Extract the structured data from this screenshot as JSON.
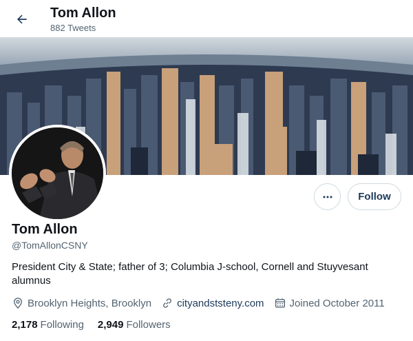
{
  "header": {
    "title": "Tom Allon",
    "tweet_count": "882 Tweets",
    "back_icon": "arrow-left-icon"
  },
  "profile": {
    "name": "Tom Allon",
    "handle": "@TomAllonCSNY",
    "bio": "President City & State; father of 3; Columbia J-school, Cornell and Stuyvesant alumnus",
    "location": "Brooklyn Heights, Brooklyn",
    "website": "cityandststeny.com",
    "joined": "Joined October 2011"
  },
  "actions": {
    "more_icon": "more-horizontal-icon",
    "follow_label": "Follow"
  },
  "stats": {
    "following_count": "2,178",
    "following_label": "Following",
    "followers_count": "2,949",
    "followers_label": "Followers"
  },
  "colors": {
    "accent": "#1d3a5c",
    "secondary_text": "#536471",
    "border": "#cfd9de"
  }
}
